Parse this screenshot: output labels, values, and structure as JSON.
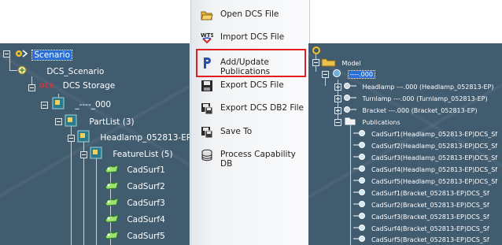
{
  "left_tree": {
    "scenario": "Scenario",
    "dcs_scenario": "DCS_Scenario",
    "dcs_storage_prefix": "DCS",
    "dcs_storage": "DCS Storage",
    "root_item": "_----_000",
    "partlist": "PartList (3)",
    "headlamp": "Headlamp_052813-EP",
    "featurelist": "FeatureList (5)",
    "cadsurfs": [
      "CadSurf1",
      "CadSurf2",
      "CadSurf3",
      "CadSurf4",
      "CadSurf5"
    ]
  },
  "menu": {
    "items": [
      {
        "label": "Open DCS File",
        "icon": "folder-open-icon"
      },
      {
        "label": "Import DCS File",
        "icon": "import-icon"
      },
      {
        "label": "Add/Update Publications",
        "icon": "publication-p-icon"
      },
      {
        "label": "Export DCS File",
        "icon": "save-disk-icon"
      },
      {
        "label": "Export DCS DB2 File",
        "icon": "save-db2-icon"
      },
      {
        "label": "Save To",
        "icon": "save-to-icon"
      },
      {
        "label": "Process Capability DB",
        "icon": "database-icon"
      }
    ],
    "import_icon_text": "WTS",
    "highlight_color": "#e02020"
  },
  "right_tree": {
    "model": "Model",
    "root": "----.000",
    "headlamp": "Headlamp ---.000 (Headlamp_052813-EP)",
    "turnlamp": "Turnlamp ---.000 (Turnlamp_052813-EP)",
    "bracket": "Bracket ---.000 (Bracket_052813-EP)",
    "publications": "Publications",
    "pubs": [
      "CadSurf1(Headlamp_052813-EP)DCS_Sf",
      "CadSurf2(Headlamp_052813-EP)DCS_Sf",
      "CadSurf3(Headlamp_052813-EP)DCS_Sf",
      "CadSurf4(Headlamp_052813-EP)DCS_Sf",
      "CadSurf5(Headlamp_052813-EP)DCS_Sf",
      "CadSurf1(Bracket_052813-EP)DCS_Sf",
      "CadSurf2(Bracket_052813-EP)DCS_Sf",
      "CadSurf3(Bracket_052813-EP)DCS_Sf",
      "CadSurf4(Bracket_052813-EP)DCS_Sf",
      "CadSurf5(Bracket_052813-EP)DCS_Sf"
    ]
  },
  "colors": {
    "tree_background": "#415b6f",
    "selection": "#2a6fd6"
  }
}
